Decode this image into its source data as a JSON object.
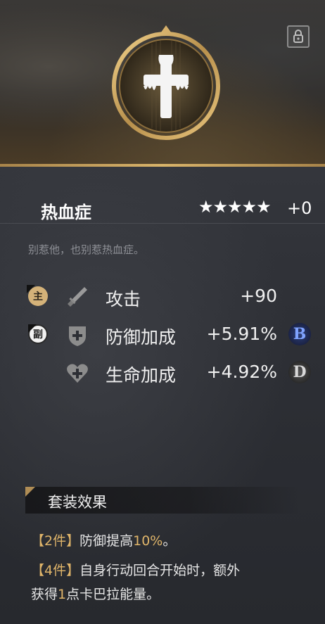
{
  "item": {
    "name": "热血症",
    "stars": "★★★★★",
    "level": "+0",
    "flavor": "别惹他，也别惹热血症。"
  },
  "main_stat": {
    "badge": "主",
    "name": "攻击",
    "value": "+90",
    "icon": "sword-icon"
  },
  "sub_stats": [
    {
      "badge": "副",
      "name": "防御加成",
      "value": "+5.91%",
      "grade": "B",
      "icon": "shield-plus-icon"
    },
    {
      "name": "生命加成",
      "value": "+4.92%",
      "grade": "D",
      "icon": "heart-plus-icon"
    }
  ],
  "set_effect": {
    "title": "套装效果",
    "piece2_tag": "【2件】",
    "piece2_text_a": "防御提高",
    "piece2_value": "10%",
    "piece2_text_b": "。",
    "piece4_tag": "【4件】",
    "piece4_text_a": "自身行动回合开始时，额外",
    "piece4_text_b": "获得",
    "piece4_value": "1",
    "piece4_text_c": "点卡巴拉能量。"
  },
  "colors": {
    "accent_gold": "#d9b46a",
    "grade_b": "#7fa3ff",
    "grade_d": "#d8d8d8"
  }
}
